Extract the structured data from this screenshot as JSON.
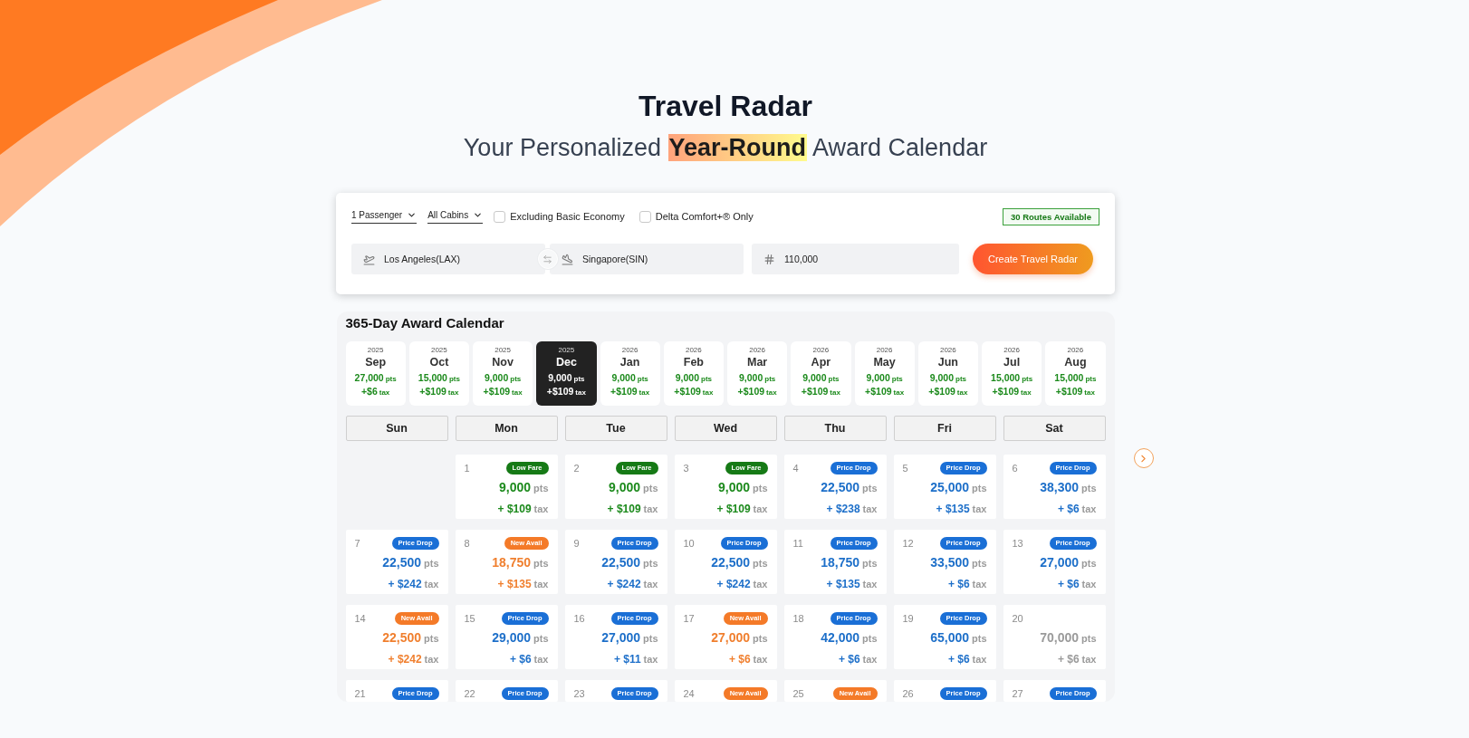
{
  "header": {
    "title": "Travel Radar",
    "subtitle": "Your Personalized **Year-Round** Award Calendar"
  },
  "search": {
    "filters": [
      {
        "kind": "dropdown",
        "label": "1 Passenger"
      },
      {
        "kind": "dropdown",
        "label": "All Cabins"
      },
      {
        "kind": "checkbox",
        "label": "Excluding Basic Economy",
        "checked": false
      },
      {
        "kind": "checkbox",
        "label": "Delta Comfort+® Only",
        "checked": false
      }
    ],
    "routes_badge": "30 Routes Available",
    "origin": {
      "value": "Los Angeles(LAX)"
    },
    "destination": {
      "value": "Singapore(SIN)"
    },
    "points": {
      "value": "110,000"
    },
    "button": "Create Travel Radar"
  },
  "calendar": {
    "title": "365-Day Award Calendar",
    "months": [
      {
        "year": "2025",
        "month": "Sep",
        "points": "27,000",
        "points_unit": "pts",
        "tax": "+$6",
        "tax_unit": "tax",
        "selected": false
      },
      {
        "year": "2025",
        "month": "Oct",
        "points": "15,000",
        "points_unit": "pts",
        "tax": "+$109",
        "tax_unit": "tax",
        "selected": false
      },
      {
        "year": "2025",
        "month": "Nov",
        "points": "9,000",
        "points_unit": "pts",
        "tax": "+$109",
        "tax_unit": "tax",
        "selected": false
      },
      {
        "year": "2025",
        "month": "Dec",
        "points": "9,000",
        "points_unit": "pts",
        "tax": "+$109",
        "tax_unit": "tax",
        "selected": true
      },
      {
        "year": "2026",
        "month": "Jan",
        "points": "9,000",
        "points_unit": "pts",
        "tax": "+$109",
        "tax_unit": "tax",
        "selected": false
      },
      {
        "year": "2026",
        "month": "Feb",
        "points": "9,000",
        "points_unit": "pts",
        "tax": "+$109",
        "tax_unit": "tax",
        "selected": false
      },
      {
        "year": "2026",
        "month": "Mar",
        "points": "9,000",
        "points_unit": "pts",
        "tax": "+$109",
        "tax_unit": "tax",
        "selected": false
      },
      {
        "year": "2026",
        "month": "Apr",
        "points": "9,000",
        "points_unit": "pts",
        "tax": "+$109",
        "tax_unit": "tax",
        "selected": false
      },
      {
        "year": "2026",
        "month": "May",
        "points": "9,000",
        "points_unit": "pts",
        "tax": "+$109",
        "tax_unit": "tax",
        "selected": false
      },
      {
        "year": "2026",
        "month": "Jun",
        "points": "9,000",
        "points_unit": "pts",
        "tax": "+$109",
        "tax_unit": "tax",
        "selected": false
      },
      {
        "year": "2026",
        "month": "Jul",
        "points": "15,000",
        "points_unit": "pts",
        "tax": "+$109",
        "tax_unit": "tax",
        "selected": false
      },
      {
        "year": "2026",
        "month": "Aug",
        "points": "15,000",
        "points_unit": "pts",
        "tax": "+$109",
        "tax_unit": "tax",
        "selected": false
      }
    ],
    "weekdays": [
      "Sun",
      "Mon",
      "Tue",
      "Wed",
      "Thu",
      "Fri",
      "Sat"
    ],
    "weeks": [
      [
        {
          "kind": "blank"
        },
        {
          "day": "1",
          "kind": "low_fare",
          "badge": "Low Fare",
          "points": "9,000",
          "points_unit": "pts",
          "tax": "+ $109",
          "tax_unit": "tax"
        },
        {
          "day": "2",
          "kind": "low_fare",
          "badge": "Low Fare",
          "points": "9,000",
          "points_unit": "pts",
          "tax": "+ $109",
          "tax_unit": "tax"
        },
        {
          "day": "3",
          "kind": "low_fare",
          "badge": "Low Fare",
          "points": "9,000",
          "points_unit": "pts",
          "tax": "+ $109",
          "tax_unit": "tax"
        },
        {
          "day": "4",
          "kind": "price_drop",
          "badge": "Price Drop",
          "points": "22,500",
          "points_unit": "pts",
          "tax": "+ $238",
          "tax_unit": "tax"
        },
        {
          "day": "5",
          "kind": "price_drop",
          "badge": "Price Drop",
          "points": "25,000",
          "points_unit": "pts",
          "tax": "+ $135",
          "tax_unit": "tax"
        },
        {
          "day": "6",
          "kind": "price_drop",
          "badge": "Price Drop",
          "points": "38,300",
          "points_unit": "pts",
          "tax": "+ $6",
          "tax_unit": "tax"
        }
      ],
      [
        {
          "day": "7",
          "kind": "price_drop",
          "badge": "Price Drop",
          "points": "22,500",
          "points_unit": "pts",
          "tax": "+ $242",
          "tax_unit": "tax"
        },
        {
          "day": "8",
          "kind": "new_avail",
          "badge": "New Avail",
          "points": "18,750",
          "points_unit": "pts",
          "tax": "+ $135",
          "tax_unit": "tax"
        },
        {
          "day": "9",
          "kind": "price_drop",
          "badge": "Price Drop",
          "points": "22,500",
          "points_unit": "pts",
          "tax": "+ $242",
          "tax_unit": "tax"
        },
        {
          "day": "10",
          "kind": "price_drop",
          "badge": "Price Drop",
          "points": "22,500",
          "points_unit": "pts",
          "tax": "+ $242",
          "tax_unit": "tax"
        },
        {
          "day": "11",
          "kind": "price_drop",
          "badge": "Price Drop",
          "points": "18,750",
          "points_unit": "pts",
          "tax": "+ $135",
          "tax_unit": "tax"
        },
        {
          "day": "12",
          "kind": "price_drop",
          "badge": "Price Drop",
          "points": "33,500",
          "points_unit": "pts",
          "tax": "+ $6",
          "tax_unit": "tax"
        },
        {
          "day": "13",
          "kind": "price_drop",
          "badge": "Price Drop",
          "points": "27,000",
          "points_unit": "pts",
          "tax": "+ $6",
          "tax_unit": "tax"
        }
      ],
      [
        {
          "day": "14",
          "kind": "new_avail",
          "badge": "New Avail",
          "points": "22,500",
          "points_unit": "pts",
          "tax": "+ $242",
          "tax_unit": "tax"
        },
        {
          "day": "15",
          "kind": "price_drop",
          "badge": "Price Drop",
          "points": "29,000",
          "points_unit": "pts",
          "tax": "+ $6",
          "tax_unit": "tax"
        },
        {
          "day": "16",
          "kind": "price_drop",
          "badge": "Price Drop",
          "points": "27,000",
          "points_unit": "pts",
          "tax": "+ $11",
          "tax_unit": "tax"
        },
        {
          "day": "17",
          "kind": "new_avail",
          "badge": "New Avail",
          "points": "27,000",
          "points_unit": "pts",
          "tax": "+ $6",
          "tax_unit": "tax"
        },
        {
          "day": "18",
          "kind": "price_drop",
          "badge": "Price Drop",
          "points": "42,000",
          "points_unit": "pts",
          "tax": "+ $6",
          "tax_unit": "tax"
        },
        {
          "day": "19",
          "kind": "price_drop",
          "badge": "Price Drop",
          "points": "65,000",
          "points_unit": "pts",
          "tax": "+ $6",
          "tax_unit": "tax"
        },
        {
          "day": "20",
          "kind": "none",
          "points": "70,000",
          "points_unit": "pts",
          "tax": "+ $6",
          "tax_unit": "tax"
        }
      ],
      [
        {
          "day": "21",
          "kind": "price_drop",
          "badge": "Price Drop"
        },
        {
          "day": "22",
          "kind": "price_drop",
          "badge": "Price Drop"
        },
        {
          "day": "23",
          "kind": "price_drop",
          "badge": "Price Drop"
        },
        {
          "day": "24",
          "kind": "new_avail",
          "badge": "New Avail"
        },
        {
          "day": "25",
          "kind": "new_avail",
          "badge": "New Avail"
        },
        {
          "day": "26",
          "kind": "price_drop",
          "badge": "Price Drop"
        },
        {
          "day": "27",
          "kind": "price_drop",
          "badge": "Price Drop"
        }
      ]
    ]
  }
}
